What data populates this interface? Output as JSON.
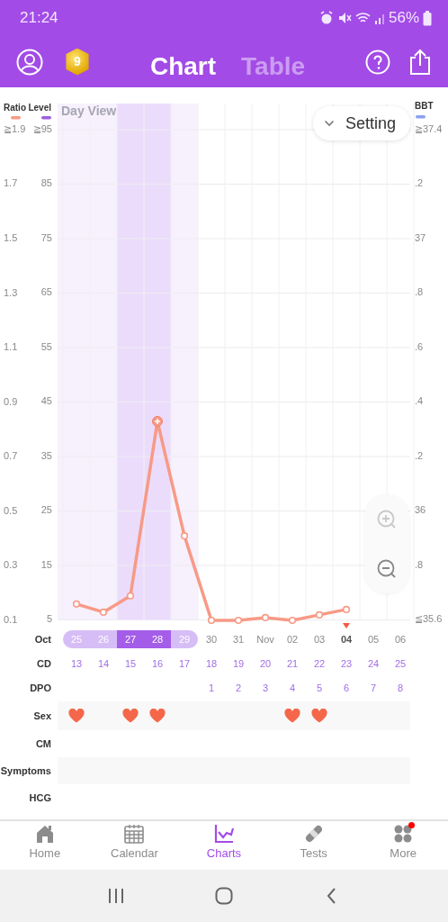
{
  "status_bar": {
    "time": "21:24",
    "battery": "56%"
  },
  "tabs": [
    {
      "label": "Chart",
      "selected": true
    },
    {
      "label": "Table",
      "selected": false
    }
  ],
  "badge": {
    "text": "9"
  },
  "legend": {
    "level": "Level",
    "bbt": "BBT"
  },
  "view_label": "Day View",
  "setting_button": "Setting",
  "level_axis": [
    "≧95",
    "85",
    "75",
    "65",
    "55",
    "45",
    "35",
    "25",
    "15",
    "5"
  ],
  "bbt_axis": [
    "≧37.4",
    ".2",
    "37",
    ".8",
    ".6",
    ".4",
    ".2",
    "36",
    ".8",
    "≦35.6"
  ],
  "chart_data": {
    "type": "line",
    "grid": true,
    "categories": [
      "25",
      "26",
      "27",
      "28",
      "29",
      "30",
      "31",
      "Nov",
      "02",
      "03",
      "04",
      "05",
      "06"
    ],
    "ylim": [
      0.1,
      1.9
    ],
    "yticks": [
      {
        "value": 1.9,
        "label": "≧1.9"
      },
      1.7,
      1.5,
      1.3,
      1.1,
      0.9,
      0.7,
      0.5,
      0.3,
      0.1
    ],
    "series": [
      {
        "name": "Ratio",
        "color": "#f79a86",
        "marker": "circle",
        "values": [
          0.16,
          0.13,
          0.19,
          0.83,
          0.41,
          0.1,
          0.1,
          0.11,
          0.1,
          0.12,
          0.14,
          null,
          null
        ]
      }
    ]
  },
  "row_labels": {
    "month": "Oct",
    "cd": "CD",
    "dpo": "DPO",
    "sex": "Sex",
    "cm": "CM",
    "symptoms": "Symptoms",
    "hcg": "HCG"
  },
  "days": [
    {
      "fertile": true,
      "peak_window": false,
      "today": false,
      "peak": false,
      "cd": "13",
      "sex": true
    },
    {
      "fertile": true,
      "peak_window": false,
      "today": false,
      "peak": false,
      "cd": "14",
      "sex": false
    },
    {
      "fertile": true,
      "peak_window": true,
      "today": false,
      "peak": false,
      "cd": "15",
      "sex": true
    },
    {
      "fertile": true,
      "peak_window": true,
      "today": false,
      "peak": true,
      "cd": "16",
      "sex": true
    },
    {
      "fertile": true,
      "peak_window": false,
      "today": false,
      "peak": false,
      "cd": "17",
      "sex": false
    },
    {
      "fertile": false,
      "today": false,
      "peak": false,
      "cd": "18",
      "dpo": "1",
      "sex": false
    },
    {
      "fertile": false,
      "today": false,
      "peak": false,
      "cd": "19",
      "dpo": "2",
      "sex": false
    },
    {
      "fertile": false,
      "today": false,
      "peak": false,
      "cd": "20",
      "dpo": "3",
      "sex": false
    },
    {
      "fertile": false,
      "today": false,
      "peak": false,
      "cd": "21",
      "dpo": "4",
      "sex": true
    },
    {
      "fertile": false,
      "today": false,
      "peak": false,
      "cd": "22",
      "dpo": "5",
      "sex": true
    },
    {
      "fertile": false,
      "today": true,
      "peak": false,
      "cd": "23",
      "dpo": "6",
      "sex": false
    },
    {
      "fertile": false,
      "today": false,
      "cd": "24",
      "dpo": "7",
      "sex": false
    },
    {
      "fertile": false,
      "today": false,
      "cd": "25",
      "dpo": "8",
      "sex": false
    }
  ],
  "bottom_nav": [
    {
      "label": "Home",
      "kind": "home",
      "selected": false,
      "notification": false
    },
    {
      "label": "Calendar",
      "kind": "calendar",
      "selected": false,
      "notification": false
    },
    {
      "label": "Charts",
      "kind": "charts",
      "selected": true,
      "notification": false
    },
    {
      "label": "Tests",
      "kind": "tests",
      "selected": false,
      "notification": false
    },
    {
      "label": "More",
      "kind": "more",
      "selected": false,
      "notification": true
    }
  ]
}
